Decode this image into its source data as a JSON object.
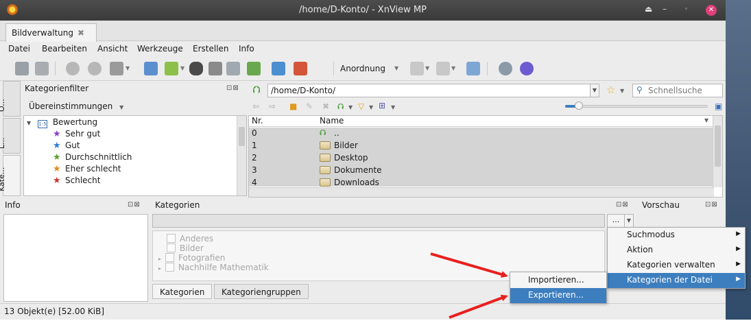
{
  "window": {
    "title": "/home/D-Konto/ - XnView MP"
  },
  "tab": {
    "label": "Bildverwaltung"
  },
  "menubar": [
    "Datei",
    "Bearbeiten",
    "Ansicht",
    "Werkzeuge",
    "Erstellen",
    "Info"
  ],
  "toolbar": {
    "arrange_label": "Anordnung"
  },
  "side_tabs": [
    "O...",
    "L...",
    "Kate..."
  ],
  "category_filter": {
    "title": "Kategorienfilter",
    "match_label": "Übereinstimmungen",
    "tree": [
      {
        "label": "Bewertung",
        "color": "#3a6ea5"
      },
      {
        "label": "Sehr gut",
        "color": "#8a3fc4"
      },
      {
        "label": "Gut",
        "color": "#2b7bd6"
      },
      {
        "label": "Durchschnittlich",
        "color": "#5f9e2f"
      },
      {
        "label": "Eher schlecht",
        "color": "#e58a1f"
      },
      {
        "label": "Schlecht",
        "color": "#d0312d"
      }
    ]
  },
  "browser": {
    "path": "/home/D-Konto/",
    "search_placeholder": "Schnellsuche",
    "columns": [
      "Nr.",
      "Name"
    ],
    "rows": [
      {
        "nr": "0",
        "name": "..",
        "icon": "up-arrow-icon"
      },
      {
        "nr": "1",
        "name": "Bilder",
        "icon": "folder-icon"
      },
      {
        "nr": "2",
        "name": "Desktop",
        "icon": "folder-icon"
      },
      {
        "nr": "3",
        "name": "Dokumente",
        "icon": "folder-icon"
      },
      {
        "nr": "4",
        "name": "Downloads",
        "icon": "folder-icon"
      }
    ]
  },
  "panels": {
    "info": "Info",
    "categories": "Kategorien",
    "preview": "Vorschau"
  },
  "categories_list": [
    "Anderes",
    "Bilder",
    "Fotografien",
    "Nachhilfe Mathematik"
  ],
  "bottom_tabs": [
    "Kategorien",
    "Kategoriengruppen"
  ],
  "more_button": "...",
  "context_menu": [
    "Suchmodus",
    "Aktion",
    "Kategorien verwalten",
    "Kategorien der Datei"
  ],
  "submenu": [
    "Importieren...",
    "Exportieren..."
  ],
  "status": "13 Objekt(e) [52.00 KiB]",
  "colors": {
    "highlight": "#3d7ebf",
    "arrow": "#e8201e"
  }
}
